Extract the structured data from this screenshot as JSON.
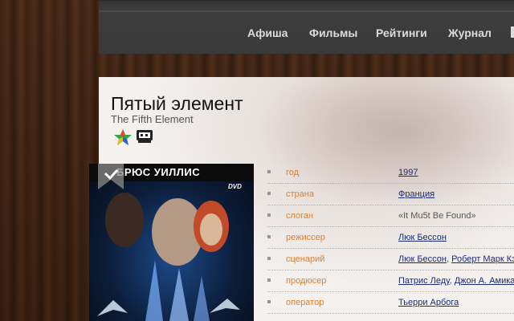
{
  "nav": {
    "items": [
      {
        "label": "Афиша"
      },
      {
        "label": "Фильмы"
      },
      {
        "label": "Рейтинги"
      },
      {
        "label": "Журнал"
      }
    ]
  },
  "movie": {
    "title": "Пятый элемент",
    "original_title": "The Fifth Element"
  },
  "poster": {
    "actor_text": "БРЮС УИЛЛИС",
    "dvd_text": "DVD"
  },
  "info": [
    {
      "label": "год",
      "values": [
        {
          "text": "1997",
          "link": true
        }
      ]
    },
    {
      "label": "страна",
      "values": [
        {
          "text": "Франция",
          "link": true
        }
      ]
    },
    {
      "label": "слоган",
      "values": [
        {
          "text": "«It Mu5t Be Found»",
          "link": false
        }
      ]
    },
    {
      "label": "режиссер",
      "values": [
        {
          "text": "Люк Бессон",
          "link": true
        }
      ]
    },
    {
      "label": "сценарий",
      "values": [
        {
          "text": "Люк Бессон",
          "link": true
        },
        {
          "text": ", ",
          "link": false
        },
        {
          "text": "Роберт Марк Кэ",
          "link": true
        }
      ]
    },
    {
      "label": "продюсер",
      "values": [
        {
          "text": "Патрис Леду",
          "link": true
        },
        {
          "text": ", ",
          "link": false
        },
        {
          "text": "Джон А. Амика",
          "link": true
        }
      ]
    },
    {
      "label": "оператор",
      "values": [
        {
          "text": "Тьерри Арбога",
          "link": true
        }
      ]
    }
  ],
  "colors": {
    "accent_label": "#e07f2a",
    "link": "#1a2a7a",
    "nav_text": "#dcdcdc"
  },
  "icons": [
    "colorful-star-icon",
    "tv-icon",
    "bookmark-icon"
  ]
}
